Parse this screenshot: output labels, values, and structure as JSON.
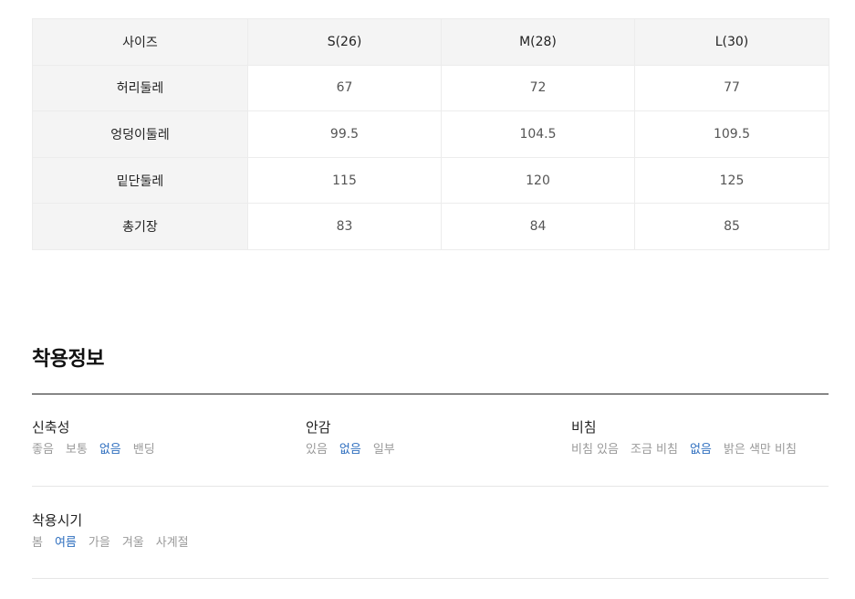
{
  "size_table": {
    "header": [
      "사이즈",
      "S(26)",
      "M(28)",
      "L(30)"
    ],
    "rows": [
      {
        "label": "허리둘레",
        "values": [
          "67",
          "72",
          "77"
        ]
      },
      {
        "label": "엉덩이둘레",
        "values": [
          "99.5",
          "104.5",
          "109.5"
        ]
      },
      {
        "label": "밑단둘레",
        "values": [
          "115",
          "120",
          "125"
        ]
      },
      {
        "label": "총기장",
        "values": [
          "83",
          "84",
          "85"
        ]
      }
    ]
  },
  "wearing_info": {
    "title": "착용정보",
    "attributes": [
      {
        "label": "신축성",
        "options": [
          "좋음",
          "보통",
          "없음",
          "밴딩"
        ],
        "selected": "없음"
      },
      {
        "label": "안감",
        "options": [
          "있음",
          "없음",
          "일부"
        ],
        "selected": "없음"
      },
      {
        "label": "비침",
        "options": [
          "비침 있음",
          "조금 비침",
          "없음",
          "밝은 색만 비침"
        ],
        "selected": "없음"
      },
      {
        "label": "착용시기",
        "options": [
          "봄",
          "여름",
          "가을",
          "겨울",
          "사계절"
        ],
        "selected": "여름"
      }
    ]
  },
  "colors": {
    "selected": "#2f6fbf",
    "unselected": "#9a9a9a",
    "header_bg": "#f4f4f4"
  }
}
